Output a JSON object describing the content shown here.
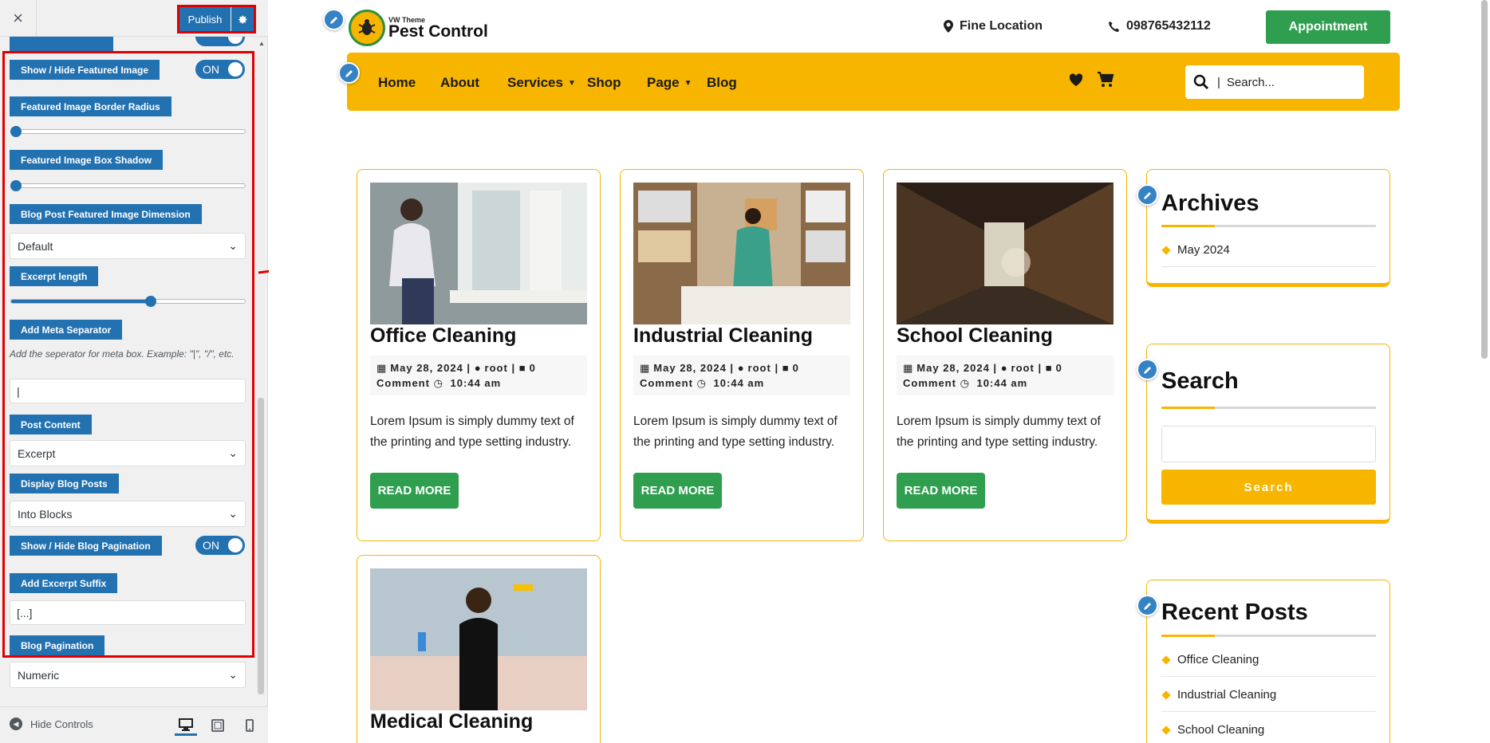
{
  "customizer": {
    "close_label": "×",
    "publish_label": "Publish",
    "sections": {
      "featured_image": {
        "label": "Show / Hide Featured Image",
        "toggle": "ON"
      },
      "border_radius": {
        "label": "Featured Image Border Radius",
        "value": 0
      },
      "box_shadow": {
        "label": "Featured Image Box Shadow",
        "value": 0
      },
      "dimension": {
        "label": "Blog Post Featured Image Dimension",
        "selected": "Default"
      },
      "excerpt_length": {
        "label": "Excerpt length",
        "value": 0.57
      },
      "meta_separator": {
        "label": "Add Meta Separator",
        "description": "Add the seperator for meta box. Example: \"|\", \"/\", etc.",
        "value": "|"
      },
      "post_content": {
        "label": "Post Content",
        "selected": "Excerpt"
      },
      "display_blog_posts": {
        "label": "Display Blog Posts",
        "selected": "Into Blocks"
      },
      "blog_pagination_toggle": {
        "label": "Show / Hide Blog Pagination",
        "toggle": "ON"
      },
      "excerpt_suffix": {
        "label": "Add Excerpt Suffix",
        "value": "[...]"
      },
      "blog_pagination": {
        "label": "Blog Pagination",
        "selected": "Numeric"
      }
    },
    "footer": {
      "hide_controls": "Hide Controls"
    }
  },
  "site": {
    "logo_small": "VW Theme",
    "logo_big": "Pest Control",
    "location": "Fine Location",
    "phone": "098765432112",
    "appointment": "Appointment",
    "nav": [
      "Home",
      "About",
      "Services",
      "Shop",
      "Page",
      "Blog"
    ],
    "search_placeholder": "Search..."
  },
  "posts": [
    {
      "title": "Office Cleaning",
      "date": "May 28, 2024",
      "author": "root",
      "comments": "0",
      "comment_label": "Comment",
      "time": "10:44 am",
      "excerpt": "Lorem Ipsum is simply dummy text of the printing and type setting industry.",
      "button": "READ MORE"
    },
    {
      "title": "Industrial Cleaning",
      "date": "May 28, 2024",
      "author": "root",
      "comments": "0",
      "comment_label": "Comment",
      "time": "10:44 am",
      "excerpt": "Lorem Ipsum is simply dummy text of the printing and type setting industry.",
      "button": "READ MORE"
    },
    {
      "title": "School Cleaning",
      "date": "May 28, 2024",
      "author": "root",
      "comments": "0",
      "comment_label": "Comment",
      "time": "10:44 am",
      "excerpt": "Lorem Ipsum is simply dummy text of the printing and type setting industry.",
      "button": "READ MORE"
    },
    {
      "title": "Medical Cleaning"
    }
  ],
  "sidebar": {
    "archives": {
      "title": "Archives",
      "items": [
        "May 2024"
      ]
    },
    "search": {
      "title": "Search",
      "button": "Search"
    },
    "recent": {
      "title": "Recent Posts",
      "items": [
        "Office Cleaning",
        "Industrial Cleaning",
        "School Cleaning"
      ]
    }
  },
  "colors": {
    "accent": "#f7b500",
    "green": "#2f9e4f",
    "wp_blue": "#2271b1",
    "highlight": "#e00000"
  }
}
